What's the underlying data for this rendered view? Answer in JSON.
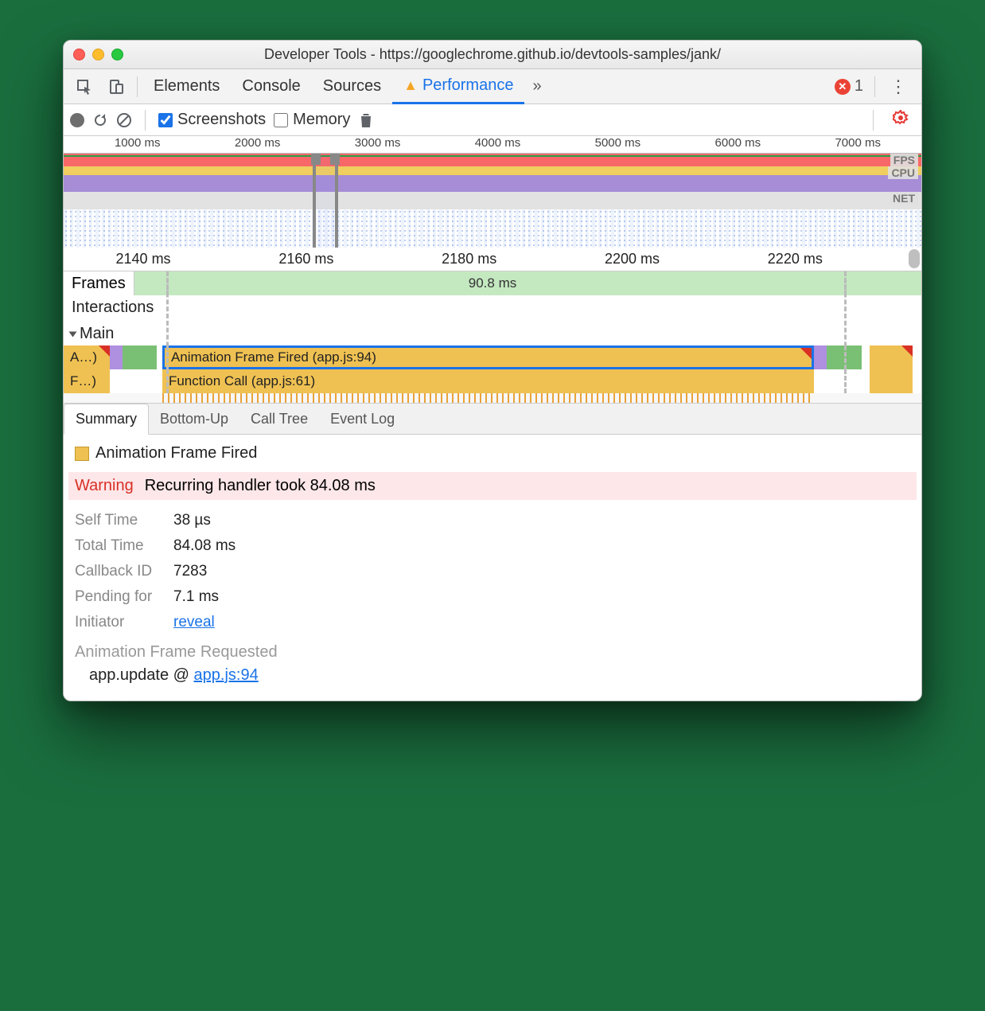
{
  "window": {
    "title": "Developer Tools - https://googlechrome.github.io/devtools-samples/jank/"
  },
  "tabs": {
    "elements": "Elements",
    "console": "Console",
    "sources": "Sources",
    "performance": "Performance",
    "overflow": "»",
    "error_count": "1"
  },
  "toolbar": {
    "screenshots_label": "Screenshots",
    "memory_label": "Memory"
  },
  "overview": {
    "ticks": [
      "1000 ms",
      "2000 ms",
      "3000 ms",
      "4000 ms",
      "5000 ms",
      "6000 ms",
      "7000 ms"
    ],
    "labels": {
      "fps": "FPS",
      "cpu": "CPU",
      "net": "NET"
    }
  },
  "detail": {
    "ticks": [
      "2140 ms",
      "2160 ms",
      "2180 ms",
      "2200 ms",
      "2220 ms"
    ],
    "frames_label": "Frames",
    "frame_duration": "90.8 ms",
    "interactions_label": "Interactions",
    "main_label": "Main",
    "bar_a": "A…)",
    "bar_f": "F…)",
    "bar_anim": "Animation Frame Fired (app.js:94)",
    "bar_func": "Function Call (app.js:61)"
  },
  "btabs": {
    "summary": "Summary",
    "bottom": "Bottom-Up",
    "calltree": "Call Tree",
    "eventlog": "Event Log"
  },
  "summary": {
    "title": "Animation Frame Fired",
    "warning_label": "Warning",
    "warning_text": "Recurring handler took 84.08 ms",
    "self_time_k": "Self Time",
    "self_time_v": "38 µs",
    "total_time_k": "Total Time",
    "total_time_v": "84.08 ms",
    "callback_k": "Callback ID",
    "callback_v": "7283",
    "pending_k": "Pending for",
    "pending_v": "7.1 ms",
    "initiator_k": "Initiator",
    "initiator_v": "reveal",
    "requested": "Animation Frame Requested",
    "stack_fn": "app.update @ ",
    "stack_link": "app.js:94"
  }
}
